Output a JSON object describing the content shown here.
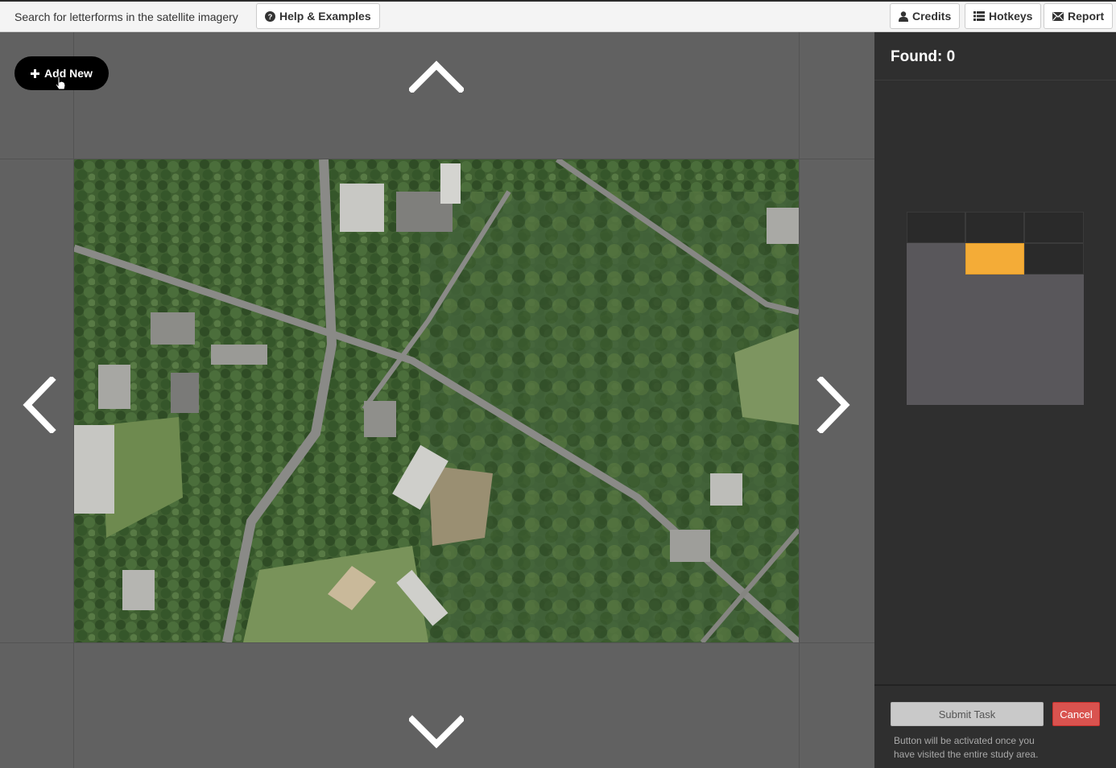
{
  "topbar": {
    "instruction": "Search for letterforms in the satellite imagery",
    "help_label": "Help & Examples",
    "credits_label": "Credits",
    "hotkeys_label": "Hotkeys",
    "report_label": "Report"
  },
  "map": {
    "add_new_label": "Add New",
    "nav": [
      "up-arrow-icon",
      "down-arrow-icon",
      "left-arrow-icon",
      "right-arrow-icon"
    ]
  },
  "sidebar": {
    "found_label": "Found: 0",
    "submit_label": "Submit Task",
    "cancel_label": "Cancel",
    "note": "Button will be activated once you have visited the entire study area."
  },
  "colors": {
    "current_tile": "#f4ac37",
    "visited_tile": "#2a2a2a",
    "unvisited_area": "#59575b",
    "cancel": "#d9534f"
  }
}
